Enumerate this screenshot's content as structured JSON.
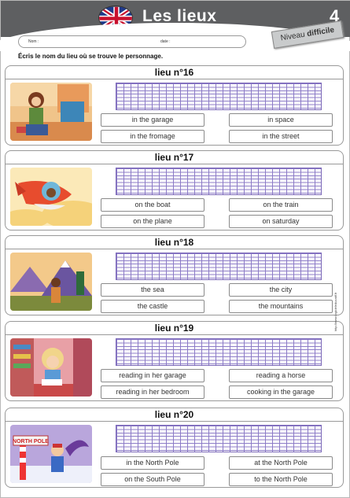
{
  "header": {
    "title": "Les lieux",
    "number": "4",
    "niveau_prefix": "Niveau ",
    "niveau_level": "difficile"
  },
  "fields": {
    "name": "Nom :",
    "date": "date :"
  },
  "instruction": "Écris le nom du lieu où se trouve le personnage.",
  "cards": [
    {
      "title": "lieu n°16",
      "options": [
        "in the garage",
        "in space",
        "in the fromage",
        "in the street"
      ]
    },
    {
      "title": "lieu n°17",
      "options": [
        "on the boat",
        "on the train",
        "on the plane",
        "on saturday"
      ]
    },
    {
      "title": "lieu n°18",
      "options": [
        "the sea",
        "the city",
        "the castle",
        "the mountains"
      ]
    },
    {
      "title": "lieu n°19",
      "options": [
        "reading in her garage",
        "reading a horse",
        "reading in her bedroom",
        "cooking in the garage"
      ]
    },
    {
      "title": "lieu n°20",
      "options": [
        "in the North Pole",
        "at the North Pole",
        "on the South Pole",
        "to the North Pole"
      ]
    }
  ],
  "illustration_text": {
    "sign": "NORTH POLE"
  },
  "side_credit": "http://www.logicieleducatif.fr"
}
